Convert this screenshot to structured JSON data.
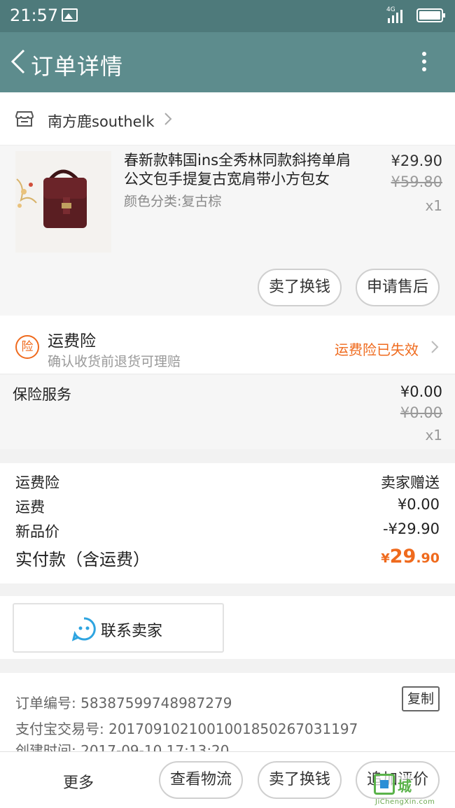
{
  "status_bar": {
    "time": "21:57",
    "network": "4G",
    "icons": [
      "image-icon",
      "signal-icon",
      "battery-icon"
    ]
  },
  "header": {
    "title": "订单详情",
    "back_icon": "back-arrow-icon",
    "menu_icon": "more-vertical-icon"
  },
  "shop": {
    "name": "南方鹿southelk",
    "icon": "store-icon"
  },
  "product": {
    "title": "春新款韩国ins全秀林同款斜挎单肩公文包手提复古宽肩带小方包女",
    "attribute": "颜色分类:复古棕",
    "price": "¥29.90",
    "original_price": "¥59.80",
    "quantity": "x1",
    "image": "brown-leather-handbag"
  },
  "product_actions": {
    "sell": "卖了换钱",
    "after_sale": "申请售后"
  },
  "insurance": {
    "badge": "险",
    "title": "运费险",
    "description": "确认收货前退货可理赔",
    "status": "运费险已失效"
  },
  "service": {
    "label": "保险服务",
    "price": "¥0.00",
    "original_price": "¥0.00",
    "quantity": "x1"
  },
  "summary": {
    "rows": [
      {
        "label": "运费险",
        "value": "卖家赠送"
      },
      {
        "label": "运费",
        "value": "¥0.00"
      },
      {
        "label": "新品价",
        "value": "-¥29.90"
      }
    ],
    "total_label": "实付款（含运费）",
    "total_currency": "¥",
    "total_integer": "29",
    "total_decimal": ".90"
  },
  "contact": {
    "label": "联系卖家",
    "icon": "chat-bubble-icon"
  },
  "order_info": {
    "order_number": "订单编号: 58387599748987279",
    "alipay_number": "支付宝交易号: 2017091021001001850267031197",
    "created_time": "创建时间: 2017-09-10 17:13:20",
    "copy_label": "复制"
  },
  "bottom_bar": {
    "more": "更多",
    "logistics": "查看物流",
    "sell": "卖了换钱",
    "review": "追加评价"
  },
  "watermark": {
    "text": "城",
    "url": "JiChengXin.com"
  },
  "colors": {
    "header": "#5d8c8d",
    "status_bar": "#4e7a7b",
    "accent": "#ef6a1d",
    "contact_icon": "#2ea4e0"
  }
}
